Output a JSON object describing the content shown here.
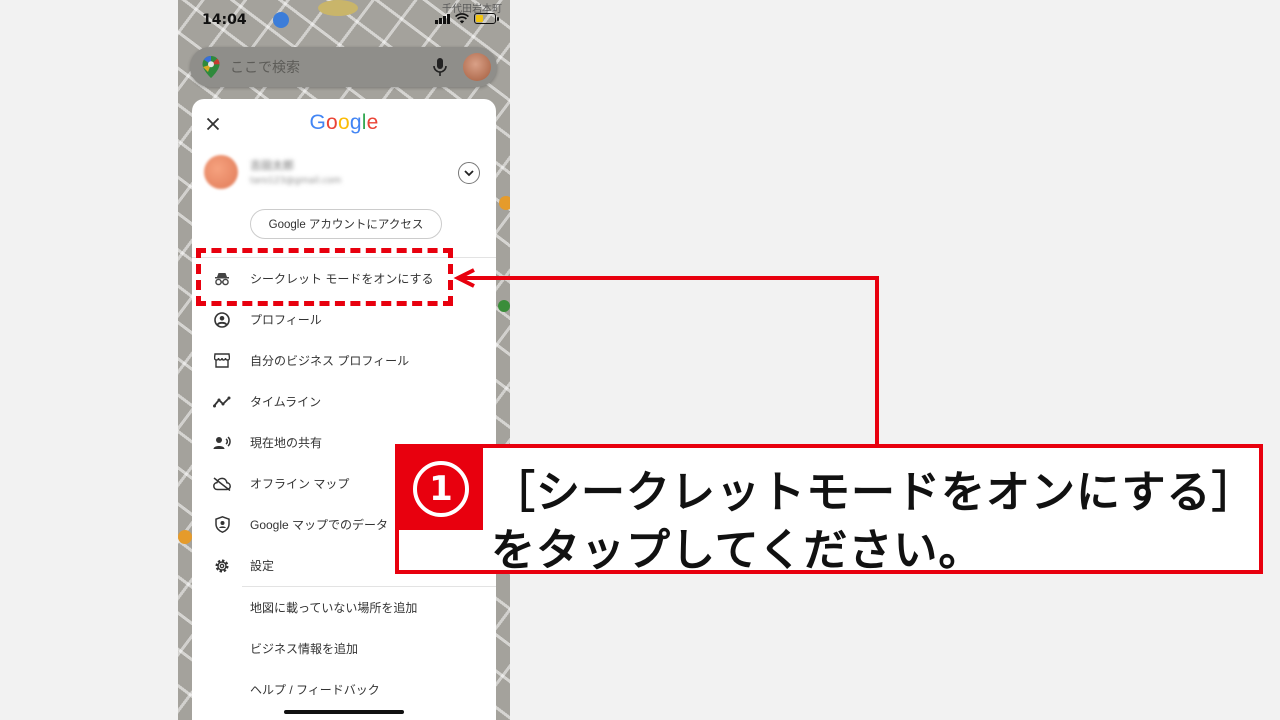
{
  "status_bar": {
    "time": "14:04",
    "map_label": "千代田岩本町"
  },
  "search": {
    "placeholder": "ここで検索"
  },
  "menu": {
    "logo": "Google",
    "account_name": "吉田太郎",
    "account_email": "taro123@gmail.com",
    "access_button": "Google アカウントにアクセス",
    "items": [
      {
        "label": "シークレット モードをオンにする",
        "icon": "incognito-icon"
      },
      {
        "label": "プロフィール",
        "icon": "account-circle-icon"
      },
      {
        "label": "自分のビジネス プロフィール",
        "icon": "storefront-icon"
      },
      {
        "label": "タイムライン",
        "icon": "timeline-icon"
      },
      {
        "label": "現在地の共有",
        "icon": "location-share-icon"
      },
      {
        "label": "オフライン マップ",
        "icon": "cloud-off-icon"
      },
      {
        "label": "Google マップでのデータ",
        "icon": "shield-account-icon"
      },
      {
        "label": "設定",
        "icon": "gear-icon"
      },
      {
        "label": "地図に載っていない場所を追加",
        "icon": ""
      },
      {
        "label": "ビジネス情報を追加",
        "icon": ""
      },
      {
        "label": "ヘルプ / フィードバック",
        "icon": ""
      }
    ]
  },
  "annotation": {
    "number": "1",
    "line1": "［シークレットモードをオンにする］",
    "line2": "をタップしてください。",
    "color": "#e8000e"
  }
}
